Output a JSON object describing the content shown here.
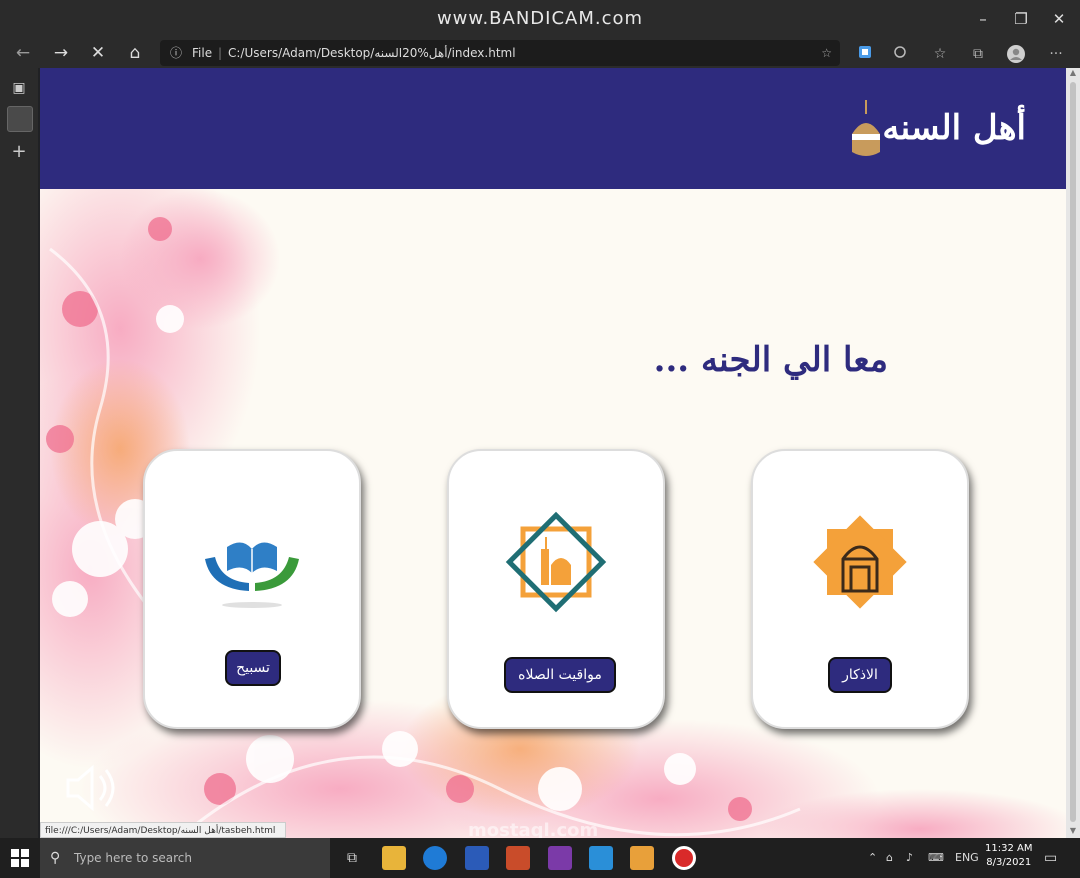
{
  "recorder": {
    "watermark": "www.BANDICAM.com"
  },
  "window_controls": {
    "minimize": "–",
    "maximize": "❐",
    "close": "✕"
  },
  "browser": {
    "nav": {
      "back": "←",
      "forward": "→",
      "stop": "✕",
      "home": "⌂"
    },
    "address": {
      "info_icon": "ⓘ",
      "file_label": "File",
      "separator": "|",
      "url": "C:/Users/Adam/Desktop/أهل%20السنه/index.html"
    },
    "toolbar_icons": [
      "collections-icon",
      "sync-icon",
      "favorites-icon",
      "split-icon",
      "profile-icon",
      "more-icon"
    ],
    "more_label": "···"
  },
  "sidebar": {
    "tab_actions_icon": "▣",
    "add_tab_icon": "+"
  },
  "page": {
    "header": {
      "title": "أهل السنه"
    },
    "tagline": "معا الي الجنه ...",
    "cards": [
      {
        "id": "tasbeh",
        "button_label": "تسبيح",
        "icon": "quran-hands-icon"
      },
      {
        "id": "prayer-times",
        "button_label": "مواقيت الصلاه",
        "icon": "mosque-star-icon"
      },
      {
        "id": "azkar",
        "button_label": "الاذكار",
        "icon": "mosque-octagram-icon"
      }
    ],
    "colors": {
      "primary": "#2e2b7e",
      "background": "#fdfaf3",
      "accent_orange": "#f4a13a",
      "accent_teal": "#1f6e74"
    }
  },
  "status_link": "file:///C:/Users/Adam/Desktop/أهل السنه/tasbeh.html",
  "overlay_watermark": "mostaql.com",
  "taskbar": {
    "search_placeholder": "Type here to search",
    "lang": "ENG",
    "time": "11:32 AM",
    "date": "8/3/2021"
  }
}
